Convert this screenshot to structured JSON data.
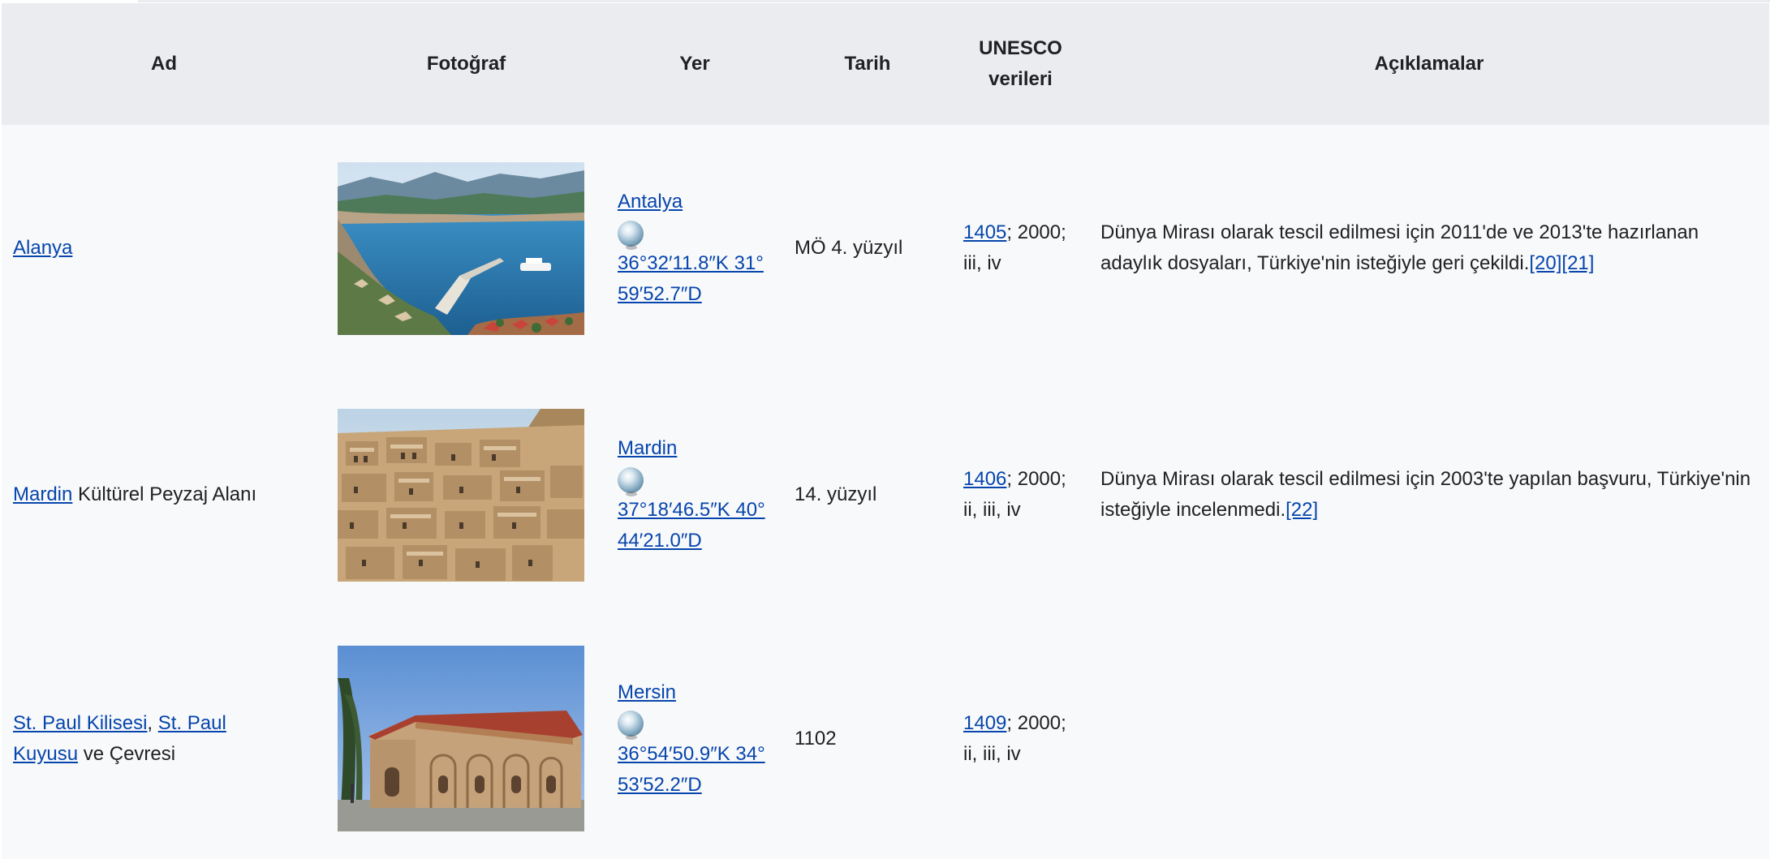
{
  "table": {
    "headers": {
      "ad": "Ad",
      "fotograf": "Fotoğraf",
      "yer": "Yer",
      "tarih": "Tarih",
      "unesco_line1": "UNESCO",
      "unesco_line2": "verileri",
      "aciklamalar": "Açıklamalar"
    },
    "rows": [
      {
        "name_link": "Alanya",
        "name_suffix": "",
        "photo_icon": "alanya-harbor-photo",
        "city": "Antalya",
        "coord_line1": "36°32′11.8″K 31°",
        "coord_line2": "59′52.7″D",
        "date": "MÖ 4. yüzyıl",
        "unesco_id": "1405",
        "unesco_rest_line1": "; 2000;",
        "unesco_rest_line2": "iii, iv",
        "notes": "Dünya Mirası olarak tescil edilmesi için 2011'de ve 2013'te hazırlanan adaylık dosyaları, Türkiye'nin isteğiyle geri çekildi.",
        "ref1": "[20]",
        "ref2": "[21]"
      },
      {
        "name_link": "Mardin",
        "name_suffix": " Kültürel Peyzaj Alanı",
        "photo_icon": "mardin-old-town-photo",
        "city": "Mardin",
        "coord_line1": "37°18′46.5″K 40°",
        "coord_line2": "44′21.0″D",
        "date": "14. yüzyıl",
        "unesco_id": "1406",
        "unesco_rest_line1": "; 2000;",
        "unesco_rest_line2": "ii, iii, iv",
        "notes": "Dünya Mirası olarak tescil edilmesi için 2003'te yapılan başvuru, Türkiye'nin isteğiyle incelenmedi.",
        "ref1": "[22]"
      },
      {
        "name_link1": "St. Paul Kilisesi",
        "name_sep": ", ",
        "name_link2_line1": "St. Paul",
        "name_link2_line2": "Kuyusu",
        "name_suffix": " ve Çevresi",
        "photo_icon": "st-paul-church-photo",
        "city": "Mersin",
        "coord_line1": "36°54′50.9″K 34°",
        "coord_line2": "53′52.2″D",
        "date": "1102",
        "unesco_id": "1409",
        "unesco_rest_line1": "; 2000;",
        "unesco_rest_line2": "ii, iii, iv",
        "notes": ""
      }
    ]
  },
  "colors": {
    "header_bg": "#eaecf0",
    "row_bg": "#f8f9fa",
    "link": "#0645ad",
    "text": "#202122"
  }
}
